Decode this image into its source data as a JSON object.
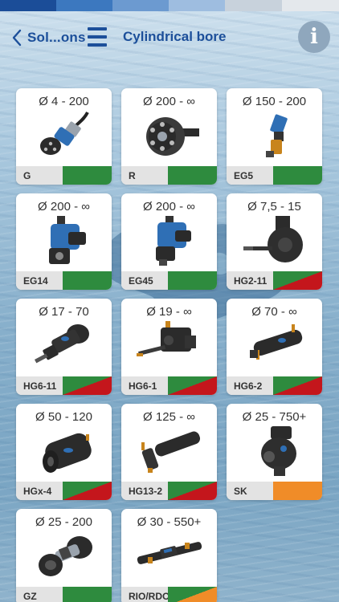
{
  "top_strip": [
    "#1b4d98",
    "#3c78bf",
    "#6c9ad0",
    "#9ebde0",
    "#c8d2dc",
    "#e4e8ec"
  ],
  "nav": {
    "back_label": "Sol...ons",
    "title": "Cylindrical bore",
    "info_label": "i"
  },
  "ratings_colors": {
    "green": "#2e8b3e",
    "red": "#c4161c",
    "orange": "#f08c28"
  },
  "products": [
    {
      "range": "Ø 4 - 200",
      "code": "G",
      "rating": "green",
      "icon": "hose-tool-icon"
    },
    {
      "range": "Ø 200 - ∞",
      "code": "R",
      "rating": "green",
      "icon": "roller-head-icon"
    },
    {
      "range": "Ø 150 - 200",
      "code": "EG5",
      "rating": "green",
      "icon": "small-head-icon"
    },
    {
      "range": "Ø 200 - ∞",
      "code": "EG14",
      "rating": "green",
      "icon": "blue-gear-head-icon"
    },
    {
      "range": "Ø 200 - ∞",
      "code": "EG45",
      "rating": "green",
      "icon": "blue-gear-head-icon"
    },
    {
      "range": "Ø 7,5 - 15",
      "code": "HG2-11",
      "rating": "green-red",
      "icon": "motor-spindle-icon"
    },
    {
      "range": "Ø 17 - 70",
      "code": "HG6-11",
      "rating": "green-red",
      "icon": "angled-drill-icon"
    },
    {
      "range": "Ø 19 - ∞",
      "code": "HG6-1",
      "rating": "green-red",
      "icon": "block-arm-icon"
    },
    {
      "range": "Ø 70 - ∞",
      "code": "HG6-2",
      "rating": "green-red",
      "icon": "long-cylinder-icon"
    },
    {
      "range": "Ø 50 - 120",
      "code": "HGx-4",
      "rating": "green-red",
      "icon": "cylinder-motor-icon"
    },
    {
      "range": "Ø 125 - ∞",
      "code": "HG13-2",
      "rating": "green-red",
      "icon": "long-rod-icon"
    },
    {
      "range": "Ø 25 - 750+",
      "code": "SK",
      "rating": "orange",
      "icon": "shaft-head-icon"
    },
    {
      "range": "Ø 25 - 200",
      "code": "GZ",
      "rating": "green",
      "icon": "spindle-icon"
    },
    {
      "range": "Ø 30 - 550+",
      "code": "RIO/RDO",
      "rating": "green-orange",
      "icon": "straight-tool-icon"
    }
  ]
}
